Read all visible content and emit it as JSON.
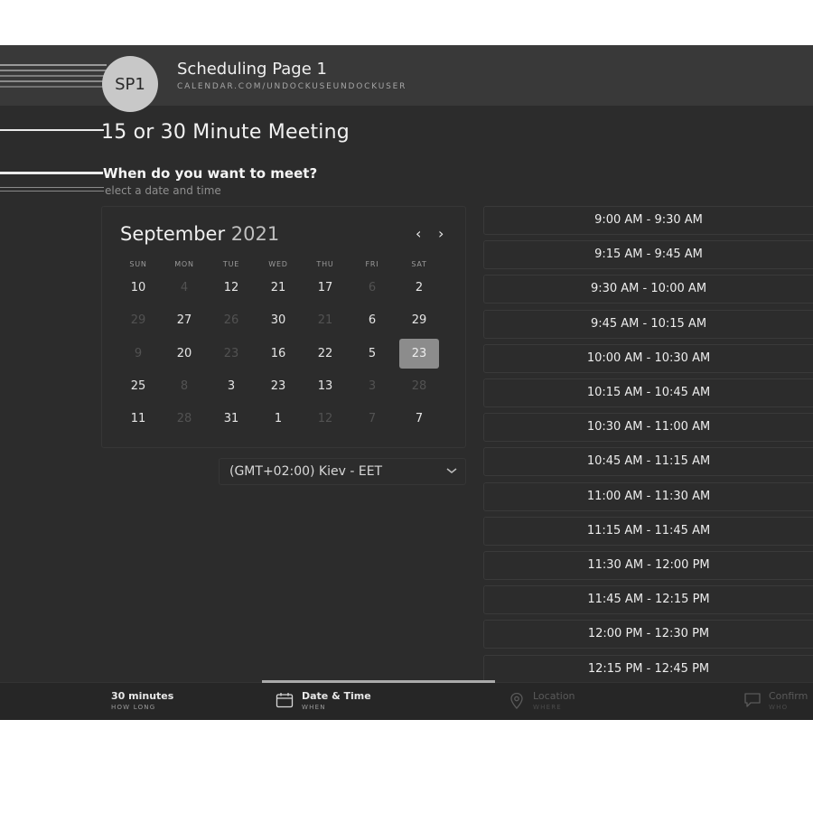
{
  "header": {
    "avatar_initials": "SP1",
    "title": "Scheduling Page 1",
    "url": "CALENDAR.COM/UNDOCKUSEUNDOCKUSER"
  },
  "meeting": {
    "title": "15 or 30 Minute Meeting",
    "question": "When do you want to meet?",
    "subtext": "elect a date and time"
  },
  "calendar": {
    "month": "September",
    "year": "2021",
    "prev_icon": "chevron-left-icon",
    "next_icon": "chevron-right-icon",
    "prev_glyph": "‹",
    "next_glyph": "›",
    "weekdays": [
      "SUN",
      "MON",
      "TUE",
      "WED",
      "THU",
      "FRI",
      "SAT"
    ],
    "weeks": [
      [
        {
          "d": "10"
        },
        {
          "d": "4",
          "muted": true
        },
        {
          "d": "12"
        },
        {
          "d": "21"
        },
        {
          "d": "17"
        },
        {
          "d": "6",
          "muted": true
        },
        {
          "d": "2"
        }
      ],
      [
        {
          "d": "29",
          "muted": true
        },
        {
          "d": "27"
        },
        {
          "d": "26",
          "muted": true
        },
        {
          "d": "30"
        },
        {
          "d": "21",
          "muted": true
        },
        {
          "d": "6"
        },
        {
          "d": "29"
        }
      ],
      [
        {
          "d": "9",
          "muted": true
        },
        {
          "d": "20"
        },
        {
          "d": "23",
          "muted": true
        },
        {
          "d": "16"
        },
        {
          "d": "22"
        },
        {
          "d": "5"
        },
        {
          "d": "23",
          "selected": true
        }
      ],
      [
        {
          "d": "25"
        },
        {
          "d": "8",
          "muted": true
        },
        {
          "d": "3"
        },
        {
          "d": "23"
        },
        {
          "d": "13"
        },
        {
          "d": "3",
          "muted": true
        },
        {
          "d": "28",
          "muted": true
        }
      ],
      [
        {
          "d": "11"
        },
        {
          "d": "28",
          "muted": true
        },
        {
          "d": "31"
        },
        {
          "d": "1"
        },
        {
          "d": "12",
          "muted": true
        },
        {
          "d": "7",
          "muted": true
        },
        {
          "d": "7"
        }
      ]
    ]
  },
  "timezone": {
    "value": "(GMT+02:00) Kiev - EET",
    "icon": "chevron-down-icon"
  },
  "slots": [
    "9:00 AM - 9:30 AM",
    "9:15 AM - 9:45 AM",
    "9:30 AM - 10:00 AM",
    "9:45 AM - 10:15 AM",
    "10:00 AM - 10:30 AM",
    "10:15 AM - 10:45 AM",
    "10:30 AM - 11:00 AM",
    "10:45 AM - 11:15 AM",
    "11:00 AM - 11:30 AM",
    "11:15 AM - 11:45 AM",
    "11:30 AM - 12:00 PM",
    "11:45 AM - 12:15 PM",
    "12:00 PM - 12:30 PM",
    "12:15 PM - 12:45 PM"
  ],
  "footer": {
    "duration": {
      "label": "30 minutes",
      "sub": "HOW LONG"
    },
    "datetime": {
      "label": "Date & Time",
      "sub": "WHEN",
      "icon": "calendar-icon"
    },
    "location": {
      "label": "Location",
      "sub": "WHERE",
      "icon": "location-pin-icon"
    },
    "confirm": {
      "label": "Confirm",
      "sub": "WHO",
      "icon": "chat-icon"
    }
  }
}
